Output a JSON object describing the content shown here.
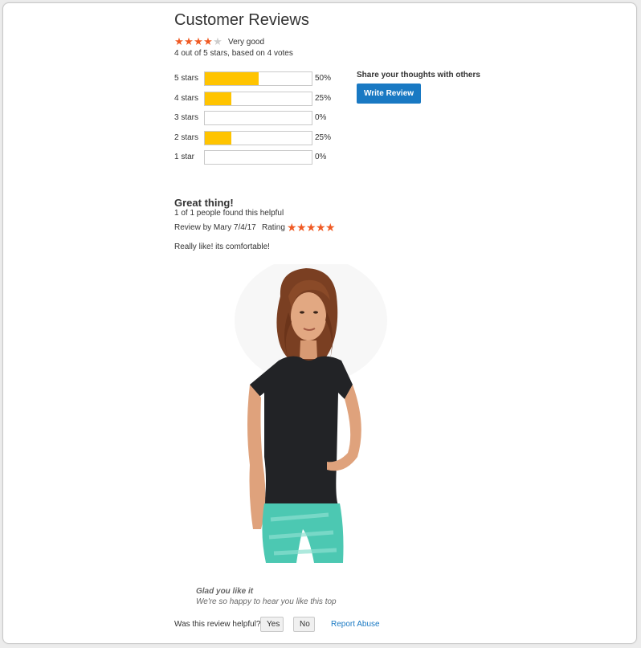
{
  "section": {
    "title": "Customer Reviews"
  },
  "summary": {
    "rating": 4,
    "max_rating": 5,
    "rating_label": "Very good",
    "text": "4 out of 5 stars, based on 4 votes",
    "star_color": "#f05a23",
    "empty_star_color": "#cdcdcd"
  },
  "distribution": [
    {
      "label": "5 stars",
      "percent": 50,
      "percent_text": "50%"
    },
    {
      "label": "4 stars",
      "percent": 25,
      "percent_text": "25%"
    },
    {
      "label": "3 stars",
      "percent": 0,
      "percent_text": "0%"
    },
    {
      "label": "2 stars",
      "percent": 25,
      "percent_text": "25%"
    },
    {
      "label": "1 star",
      "percent": 0,
      "percent_text": "0%"
    }
  ],
  "bar_color": "#ffc400",
  "share": {
    "prompt": "Share your thoughts with others",
    "button_label": "Write Review",
    "button_color": "#1979c3"
  },
  "review": {
    "title": "Great thing!",
    "helpful_count": "1 of 1 people found this helpful",
    "meta": "Review by Mary 7/4/17",
    "rating_label": "Rating",
    "rating": 5,
    "body": "Really like! its comfortable!",
    "photo": "woman-in-black-tee-and-teal-pants"
  },
  "reply": {
    "title": "Glad you like it",
    "body": "We're so happy to hear you like this top"
  },
  "feedback": {
    "question": "Was this review helpful?",
    "yes_label": "Yes",
    "no_label": "No",
    "report_label": "Report Abuse",
    "link_color": "#1979c3"
  }
}
